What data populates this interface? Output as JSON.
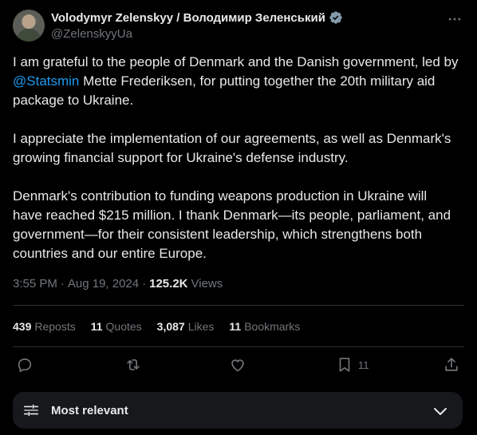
{
  "author": {
    "display_name": "Volodymyr Zelenskyy / Володимир Зеленський",
    "handle": "@ZelenskyyUa"
  },
  "post": {
    "p1_before": "I am grateful to the people of Denmark and the Danish government, led by ",
    "p1_mention": "@Statsmin",
    "p1_after": " Mette Frederiksen, for putting together the 20th military aid package to Ukraine.",
    "p2": "I appreciate the implementation of our agreements, as well as Denmark's growing financial support for Ukraine's defense industry.",
    "p3": "Denmark's contribution to funding weapons production in Ukraine will have reached $215 million. I thank Denmark—its people, parliament, and government—for their consistent leadership, which strengthens both countries and our entire Europe."
  },
  "meta": {
    "time": "3:55 PM",
    "sep1": "·",
    "date": "Aug 19, 2024",
    "sep2": "·",
    "views_count": "125.2K",
    "views_label": "Views"
  },
  "stats": {
    "reposts_count": "439",
    "reposts_label": "Reposts",
    "quotes_count": "11",
    "quotes_label": "Quotes",
    "likes_count": "3,087",
    "likes_label": "Likes",
    "bookmarks_count": "11",
    "bookmarks_label": "Bookmarks"
  },
  "actions": {
    "bookmark_count": "11"
  },
  "sort": {
    "label": "Most relevant"
  },
  "colors": {
    "background": "#000000",
    "text": "#e7e9ea",
    "muted": "#71767b",
    "accent": "#1d9bf0"
  },
  "icons": [
    "verified-badge-icon",
    "more-icon",
    "reply-icon",
    "repost-icon",
    "like-icon",
    "bookmark-icon",
    "share-icon",
    "filter-icon",
    "chevron-down-icon"
  ]
}
